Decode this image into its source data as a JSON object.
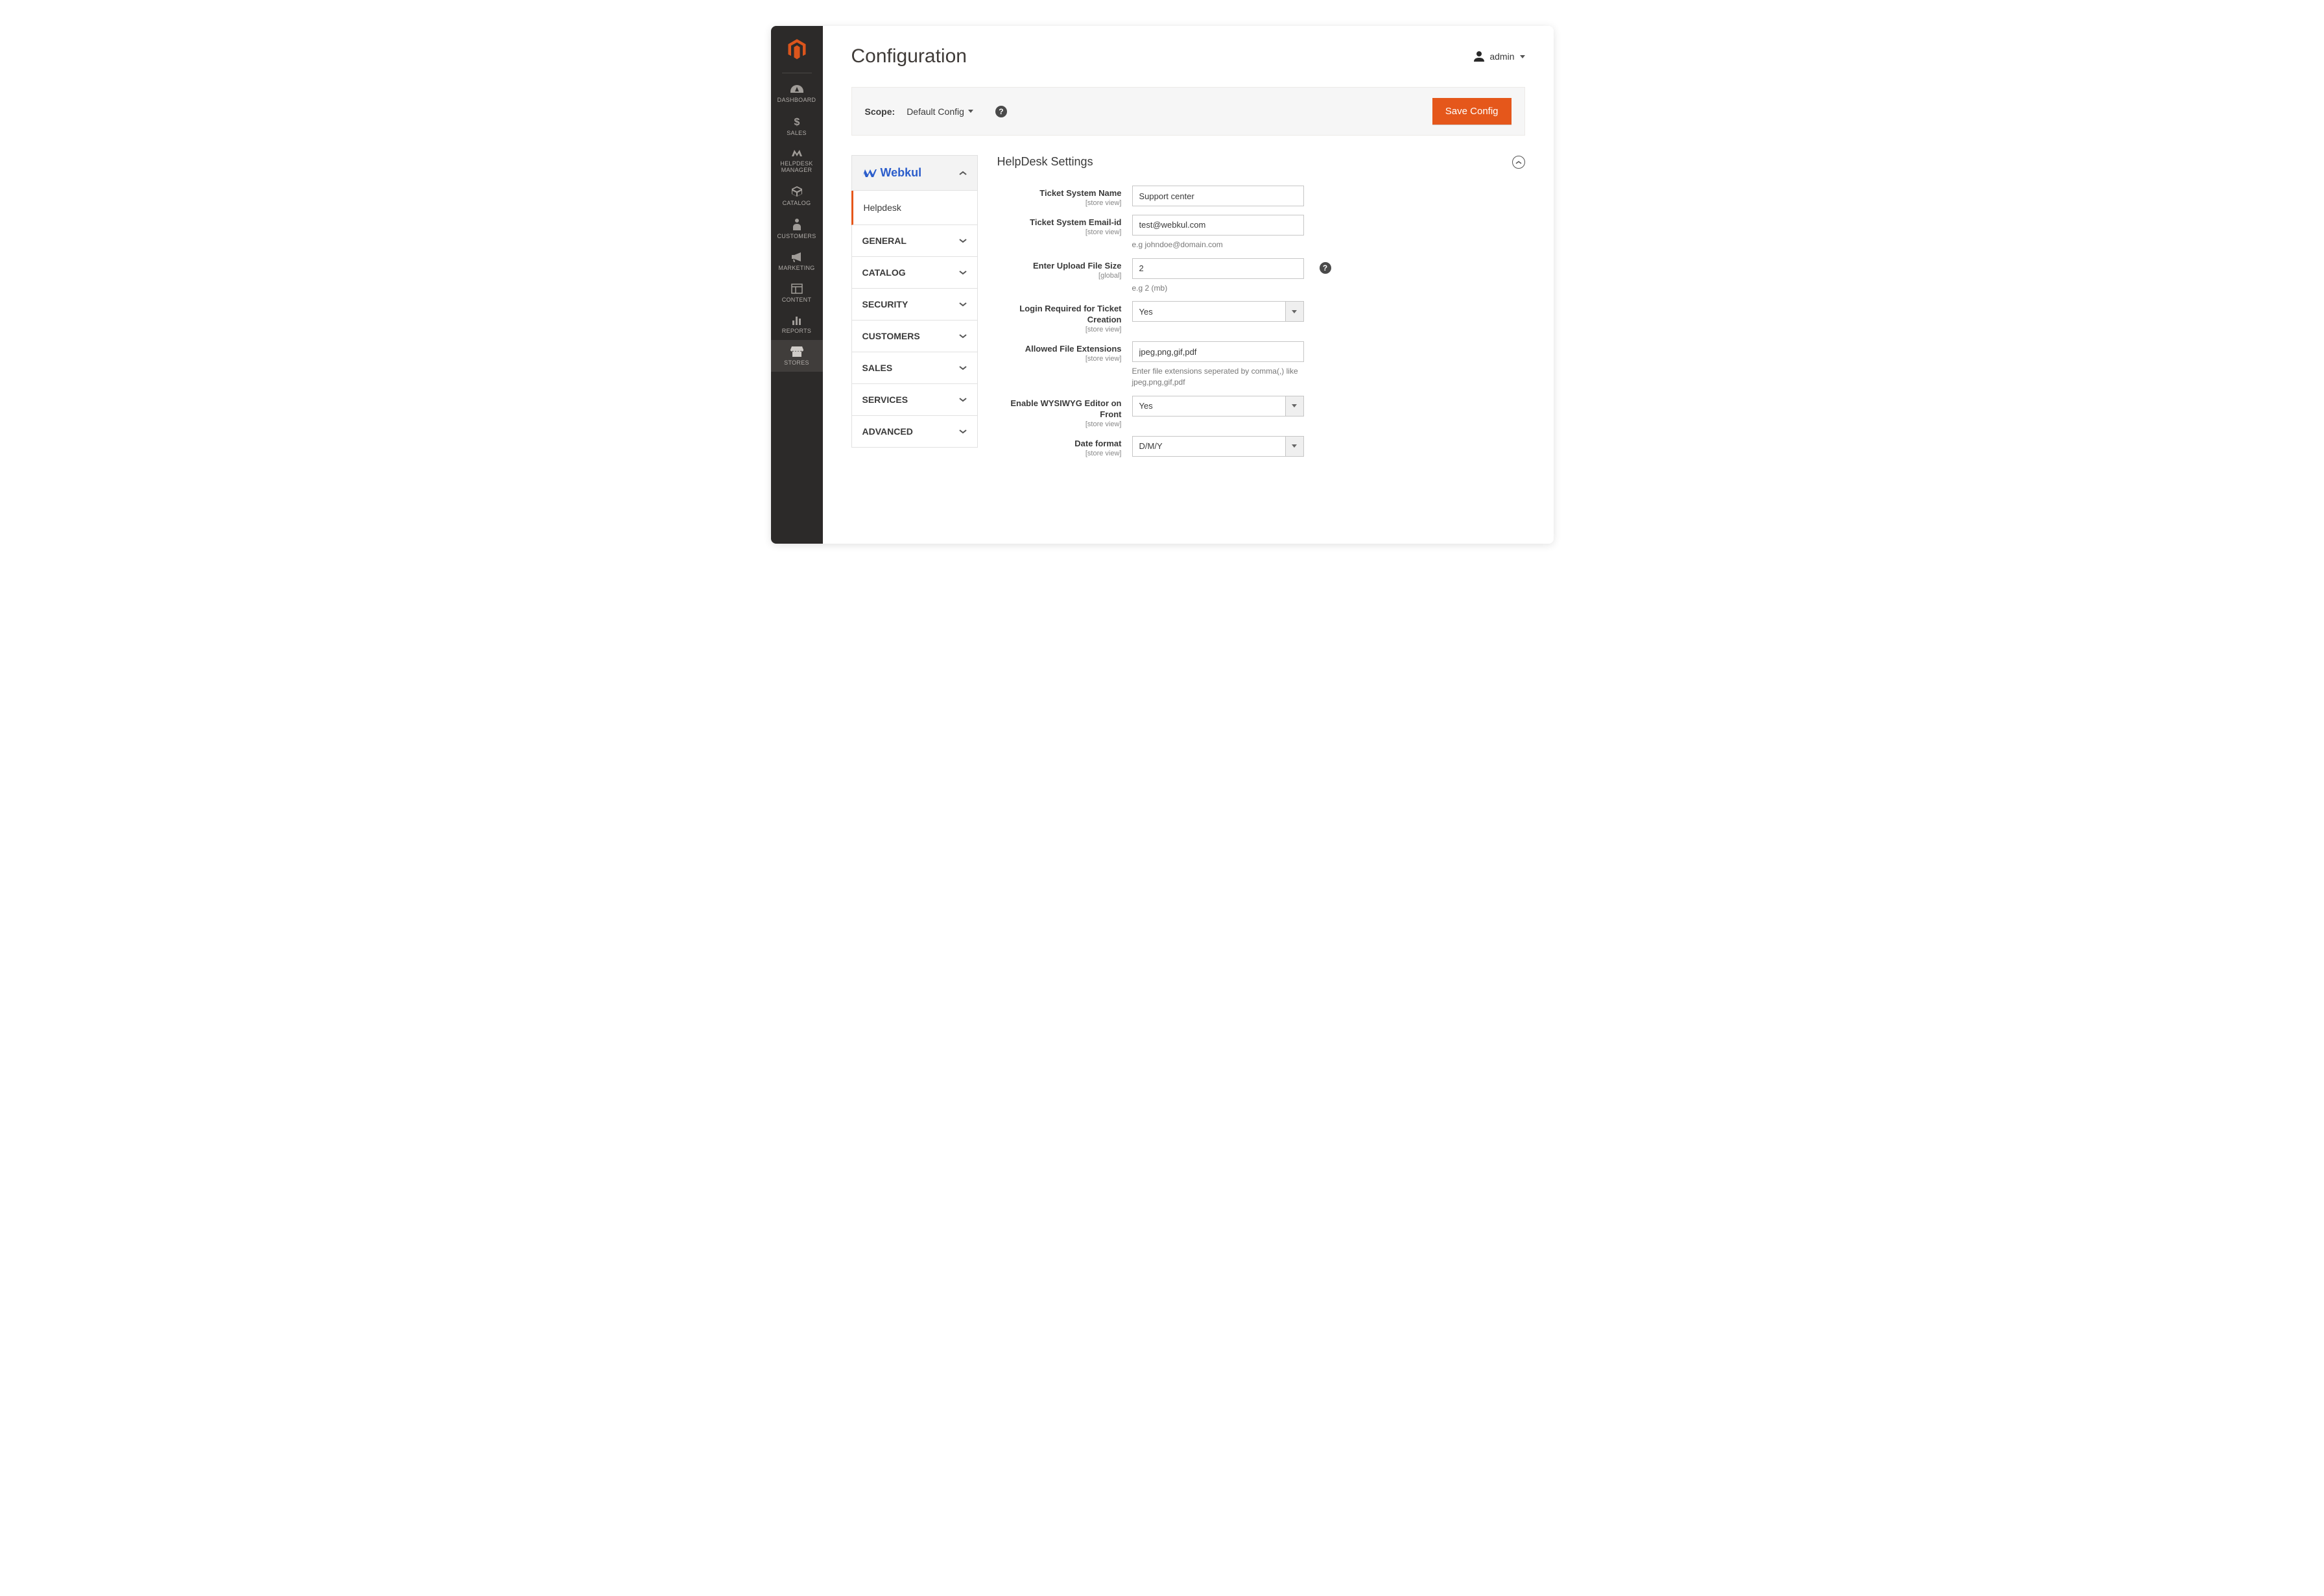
{
  "sidebar": {
    "items": [
      {
        "label": "DASHBOARD"
      },
      {
        "label": "SALES"
      },
      {
        "label": "HELPDESK MANAGER"
      },
      {
        "label": "CATALOG"
      },
      {
        "label": "CUSTOMERS"
      },
      {
        "label": "MARKETING"
      },
      {
        "label": "CONTENT"
      },
      {
        "label": "REPORTS"
      },
      {
        "label": "STORES"
      }
    ]
  },
  "header": {
    "title": "Configuration",
    "user": "admin"
  },
  "scopebar": {
    "label": "Scope:",
    "value": "Default Config",
    "save": "Save Config"
  },
  "tabs": {
    "brand": "Webkul",
    "sub": "Helpdesk",
    "items": [
      {
        "label": "GENERAL"
      },
      {
        "label": "CATALOG"
      },
      {
        "label": "SECURITY"
      },
      {
        "label": "CUSTOMERS"
      },
      {
        "label": "SALES"
      },
      {
        "label": "SERVICES"
      },
      {
        "label": "ADVANCED"
      }
    ]
  },
  "section": {
    "title": "HelpDesk Settings"
  },
  "fields": {
    "ticket_name": {
      "label": "Ticket System Name",
      "scope": "[store view]",
      "value": "Support center"
    },
    "ticket_email": {
      "label": "Ticket System Email-id",
      "scope": "[store view]",
      "value": "test@webkul.com",
      "hint": "e.g johndoe@domain.com"
    },
    "upload_size": {
      "label": "Enter Upload File Size",
      "scope": "[global]",
      "value": "2",
      "hint": "e.g 2 (mb)"
    },
    "login_req": {
      "label": "Login Required for Ticket Creation",
      "scope": "[store view]",
      "value": "Yes"
    },
    "file_ext": {
      "label": "Allowed File Extensions",
      "scope": "[store view]",
      "value": "jpeg,png,gif,pdf",
      "hint": "Enter file extensions seperated by comma(,) like jpeg,png,gif,pdf"
    },
    "wysiwyg": {
      "label": "Enable WYSIWYG Editor on Front",
      "scope": "[store view]",
      "value": "Yes"
    },
    "date_fmt": {
      "label": "Date format",
      "scope": "[store view]",
      "value": "D/M/Y"
    }
  }
}
